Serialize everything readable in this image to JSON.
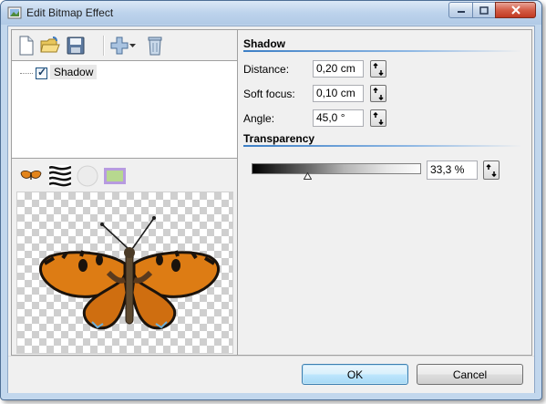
{
  "window": {
    "title": "Edit Bitmap Effect",
    "app_icon": "bitmap-effect-icon",
    "caption_buttons": [
      "minimize-icon",
      "maximize-icon",
      "close-icon"
    ]
  },
  "toolbar": {
    "icons": [
      "new-document-icon",
      "open-folder-icon",
      "save-icon",
      "add-effect-icon",
      "dropdown-arrow-icon",
      "delete-icon"
    ]
  },
  "effects_tree": {
    "items": [
      {
        "label": "Shadow",
        "checked": true
      }
    ]
  },
  "preview": {
    "icons": [
      "butterfly-thumbnail-icon",
      "zebra-pattern-icon",
      "circle-shape-icon",
      "rectangle-shape-icon"
    ],
    "image": "butterfly-image"
  },
  "shadow": {
    "heading": "Shadow",
    "distance_label": "Distance:",
    "distance_value": "0,20 cm",
    "soft_focus_label": "Soft focus:",
    "soft_focus_value": "0,10 cm",
    "angle_label": "Angle:",
    "angle_value": "45,0 °"
  },
  "transparency": {
    "heading": "Transparency",
    "value": "33,3 %",
    "level": 0.333
  },
  "buttons": {
    "ok": "OK",
    "cancel": "Cancel"
  },
  "colors": {
    "section_line": "#3c7fc6",
    "window_frame": "#c2d7ed",
    "close_button": "#c13a22"
  }
}
